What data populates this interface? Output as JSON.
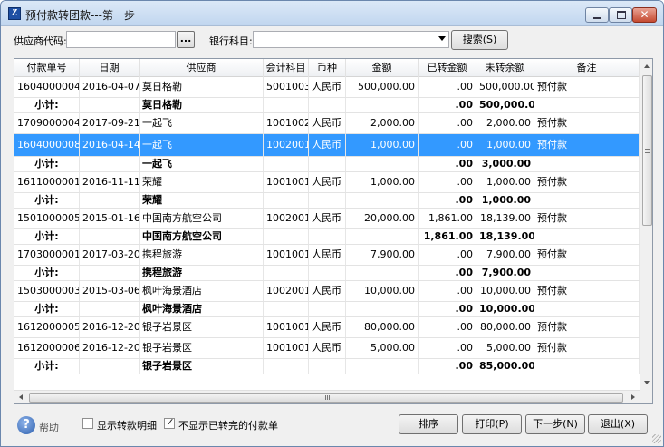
{
  "window": {
    "title": "预付款转团款---第一步",
    "app_icon": "Z",
    "controls": {
      "minimize": "minimize-icon",
      "maximize": "maximize-icon",
      "close": "close-icon",
      "close_glyph": "✕"
    }
  },
  "toolbar": {
    "supplier_label": "供应商代码:",
    "supplier_value": "",
    "browse_label": "...",
    "bank_label": "银行科目:",
    "bank_value": "",
    "search_label": "搜索(S)"
  },
  "table": {
    "columns": [
      "付款单号",
      "日期",
      "供应商",
      "会计科目",
      "币种",
      "金额",
      "已转金额",
      "未转余额",
      "备注"
    ],
    "rows": [
      {
        "type": "data",
        "cells": [
          "1604000004",
          "2016-04-07",
          "莫日格勒",
          "5001003",
          "人民币",
          "500,000.00",
          ".00",
          "500,000.00",
          "预付款"
        ]
      },
      {
        "type": "subtotal",
        "cells": [
          "小计:",
          "",
          "莫日格勒",
          "",
          "",
          "",
          ".00",
          "500,000.00",
          ""
        ]
      },
      {
        "type": "data",
        "cells": [
          "1709000004",
          "2017-09-21",
          "一起飞",
          "1001002001",
          "人民币",
          "2,000.00",
          ".00",
          "2,000.00",
          "预付款"
        ]
      },
      {
        "type": "selected",
        "cells": [
          "1604000008",
          "2016-04-14",
          "一起飞",
          "1002001",
          "人民币",
          "1,000.00",
          ".00",
          "1,000.00",
          "预付款"
        ]
      },
      {
        "type": "subtotal",
        "cells": [
          "小计:",
          "",
          "一起飞",
          "",
          "",
          "",
          ".00",
          "3,000.00",
          ""
        ]
      },
      {
        "type": "data",
        "cells": [
          "1611000001",
          "2016-11-11",
          "荣耀",
          "1001001",
          "人民币",
          "1,000.00",
          ".00",
          "1,000.00",
          "预付款"
        ]
      },
      {
        "type": "subtotal",
        "cells": [
          "小计:",
          "",
          "荣耀",
          "",
          "",
          "",
          ".00",
          "1,000.00",
          ""
        ]
      },
      {
        "type": "data",
        "cells": [
          "1501000005",
          "2015-01-16",
          "中国南方航空公司",
          "1002001",
          "人民币",
          "20,000.00",
          "1,861.00",
          "18,139.00",
          "预付款"
        ]
      },
      {
        "type": "subtotal",
        "cells": [
          "小计:",
          "",
          "中国南方航空公司",
          "",
          "",
          "",
          "1,861.00",
          "18,139.00",
          ""
        ]
      },
      {
        "type": "data",
        "cells": [
          "1703000001",
          "2017-03-20",
          "携程旅游",
          "1001001",
          "人民币",
          "7,900.00",
          ".00",
          "7,900.00",
          "预付款"
        ]
      },
      {
        "type": "subtotal",
        "cells": [
          "小计:",
          "",
          "携程旅游",
          "",
          "",
          "",
          ".00",
          "7,900.00",
          ""
        ]
      },
      {
        "type": "data",
        "cells": [
          "1503000003",
          "2015-03-06",
          "枫叶海景酒店",
          "1002001",
          "人民币",
          "10,000.00",
          ".00",
          "10,000.00",
          "预付款"
        ]
      },
      {
        "type": "subtotal",
        "cells": [
          "小计:",
          "",
          "枫叶海景酒店",
          "",
          "",
          "",
          ".00",
          "10,000.00",
          ""
        ]
      },
      {
        "type": "data",
        "cells": [
          "1612000005",
          "2016-12-20",
          "银子岩景区",
          "1001001",
          "人民币",
          "80,000.00",
          ".00",
          "80,000.00",
          "预付款"
        ]
      },
      {
        "type": "data",
        "cells": [
          "1612000006",
          "2016-12-20",
          "银子岩景区",
          "1001001",
          "人民币",
          "5,000.00",
          ".00",
          "5,000.00",
          "预付款"
        ]
      },
      {
        "type": "subtotal",
        "cells": [
          "小计:",
          "",
          "银子岩景区",
          "",
          "",
          "",
          ".00",
          "85,000.00",
          ""
        ]
      }
    ]
  },
  "footer": {
    "help_label": "帮助",
    "help_glyph": "?",
    "show_detail_label": "显示转款明细",
    "show_detail_checked": false,
    "hide_done_label": "不显示已转完的付款单",
    "hide_done_checked": true,
    "check_glyph": "✓",
    "sort_label": "排序",
    "print_label": "打印(P)",
    "next_label": "下一步(N)",
    "exit_label": "退出(X)"
  },
  "scrollbar": {
    "hscroll_glyph": "Ⅲ"
  },
  "colors": {
    "selection": "#3399ff",
    "title_bar": "#c1d6ef"
  }
}
